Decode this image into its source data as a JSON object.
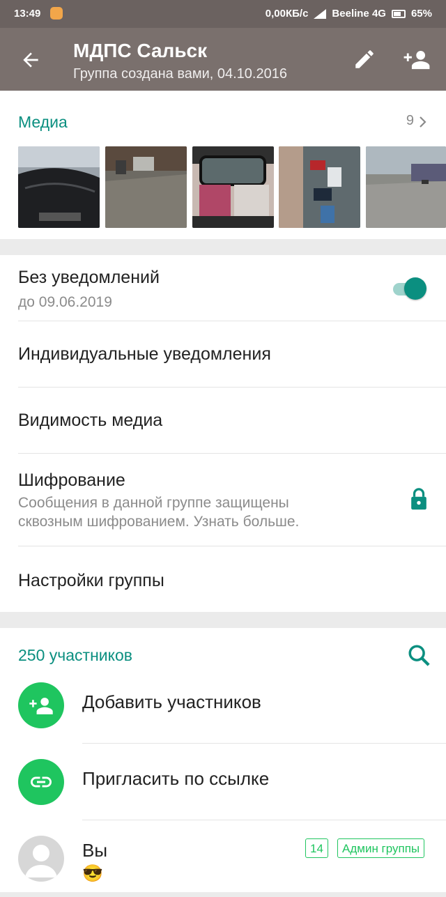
{
  "status_bar": {
    "time": "13:49",
    "network_speed": "0,00КБ/с",
    "carrier": "Beeline 4G",
    "battery": "65%"
  },
  "app_bar": {
    "title": "МДПС Сальск",
    "subtitle": "Группа создана вами, 04.10.2016",
    "icons": [
      "back-arrow-icon",
      "edit-icon",
      "add-person-icon"
    ]
  },
  "media": {
    "label": "Медиа",
    "count": "9",
    "thumbnails": [
      "media-thumb-1",
      "media-thumb-2",
      "media-thumb-3",
      "media-thumb-4",
      "media-thumb-5"
    ]
  },
  "settings": {
    "mute": {
      "title": "Без уведомлений",
      "subtitle": "до 09.06.2019",
      "enabled": true
    },
    "custom_notifications": {
      "title": "Индивидуальные уведомления"
    },
    "media_visibility": {
      "title": "Видимость медиа"
    },
    "encryption": {
      "title": "Шифрование",
      "subtitle_line1": "Сообщения в данной группе защищены",
      "subtitle_line2": "сквозным шифрованием. Узнать больше."
    },
    "group_settings": {
      "title": "Настройки группы"
    }
  },
  "members": {
    "count_label": "250 участников",
    "add_label": "Добавить участников",
    "invite_label": "Пригласить по ссылке",
    "you": {
      "name": "Вы",
      "status_emoji": "😎",
      "badge_count": "14",
      "badge_role": "Админ группы"
    }
  },
  "colors": {
    "accent": "#0b8f80",
    "app_bar": "#7a706d",
    "green": "#1fc55f"
  }
}
